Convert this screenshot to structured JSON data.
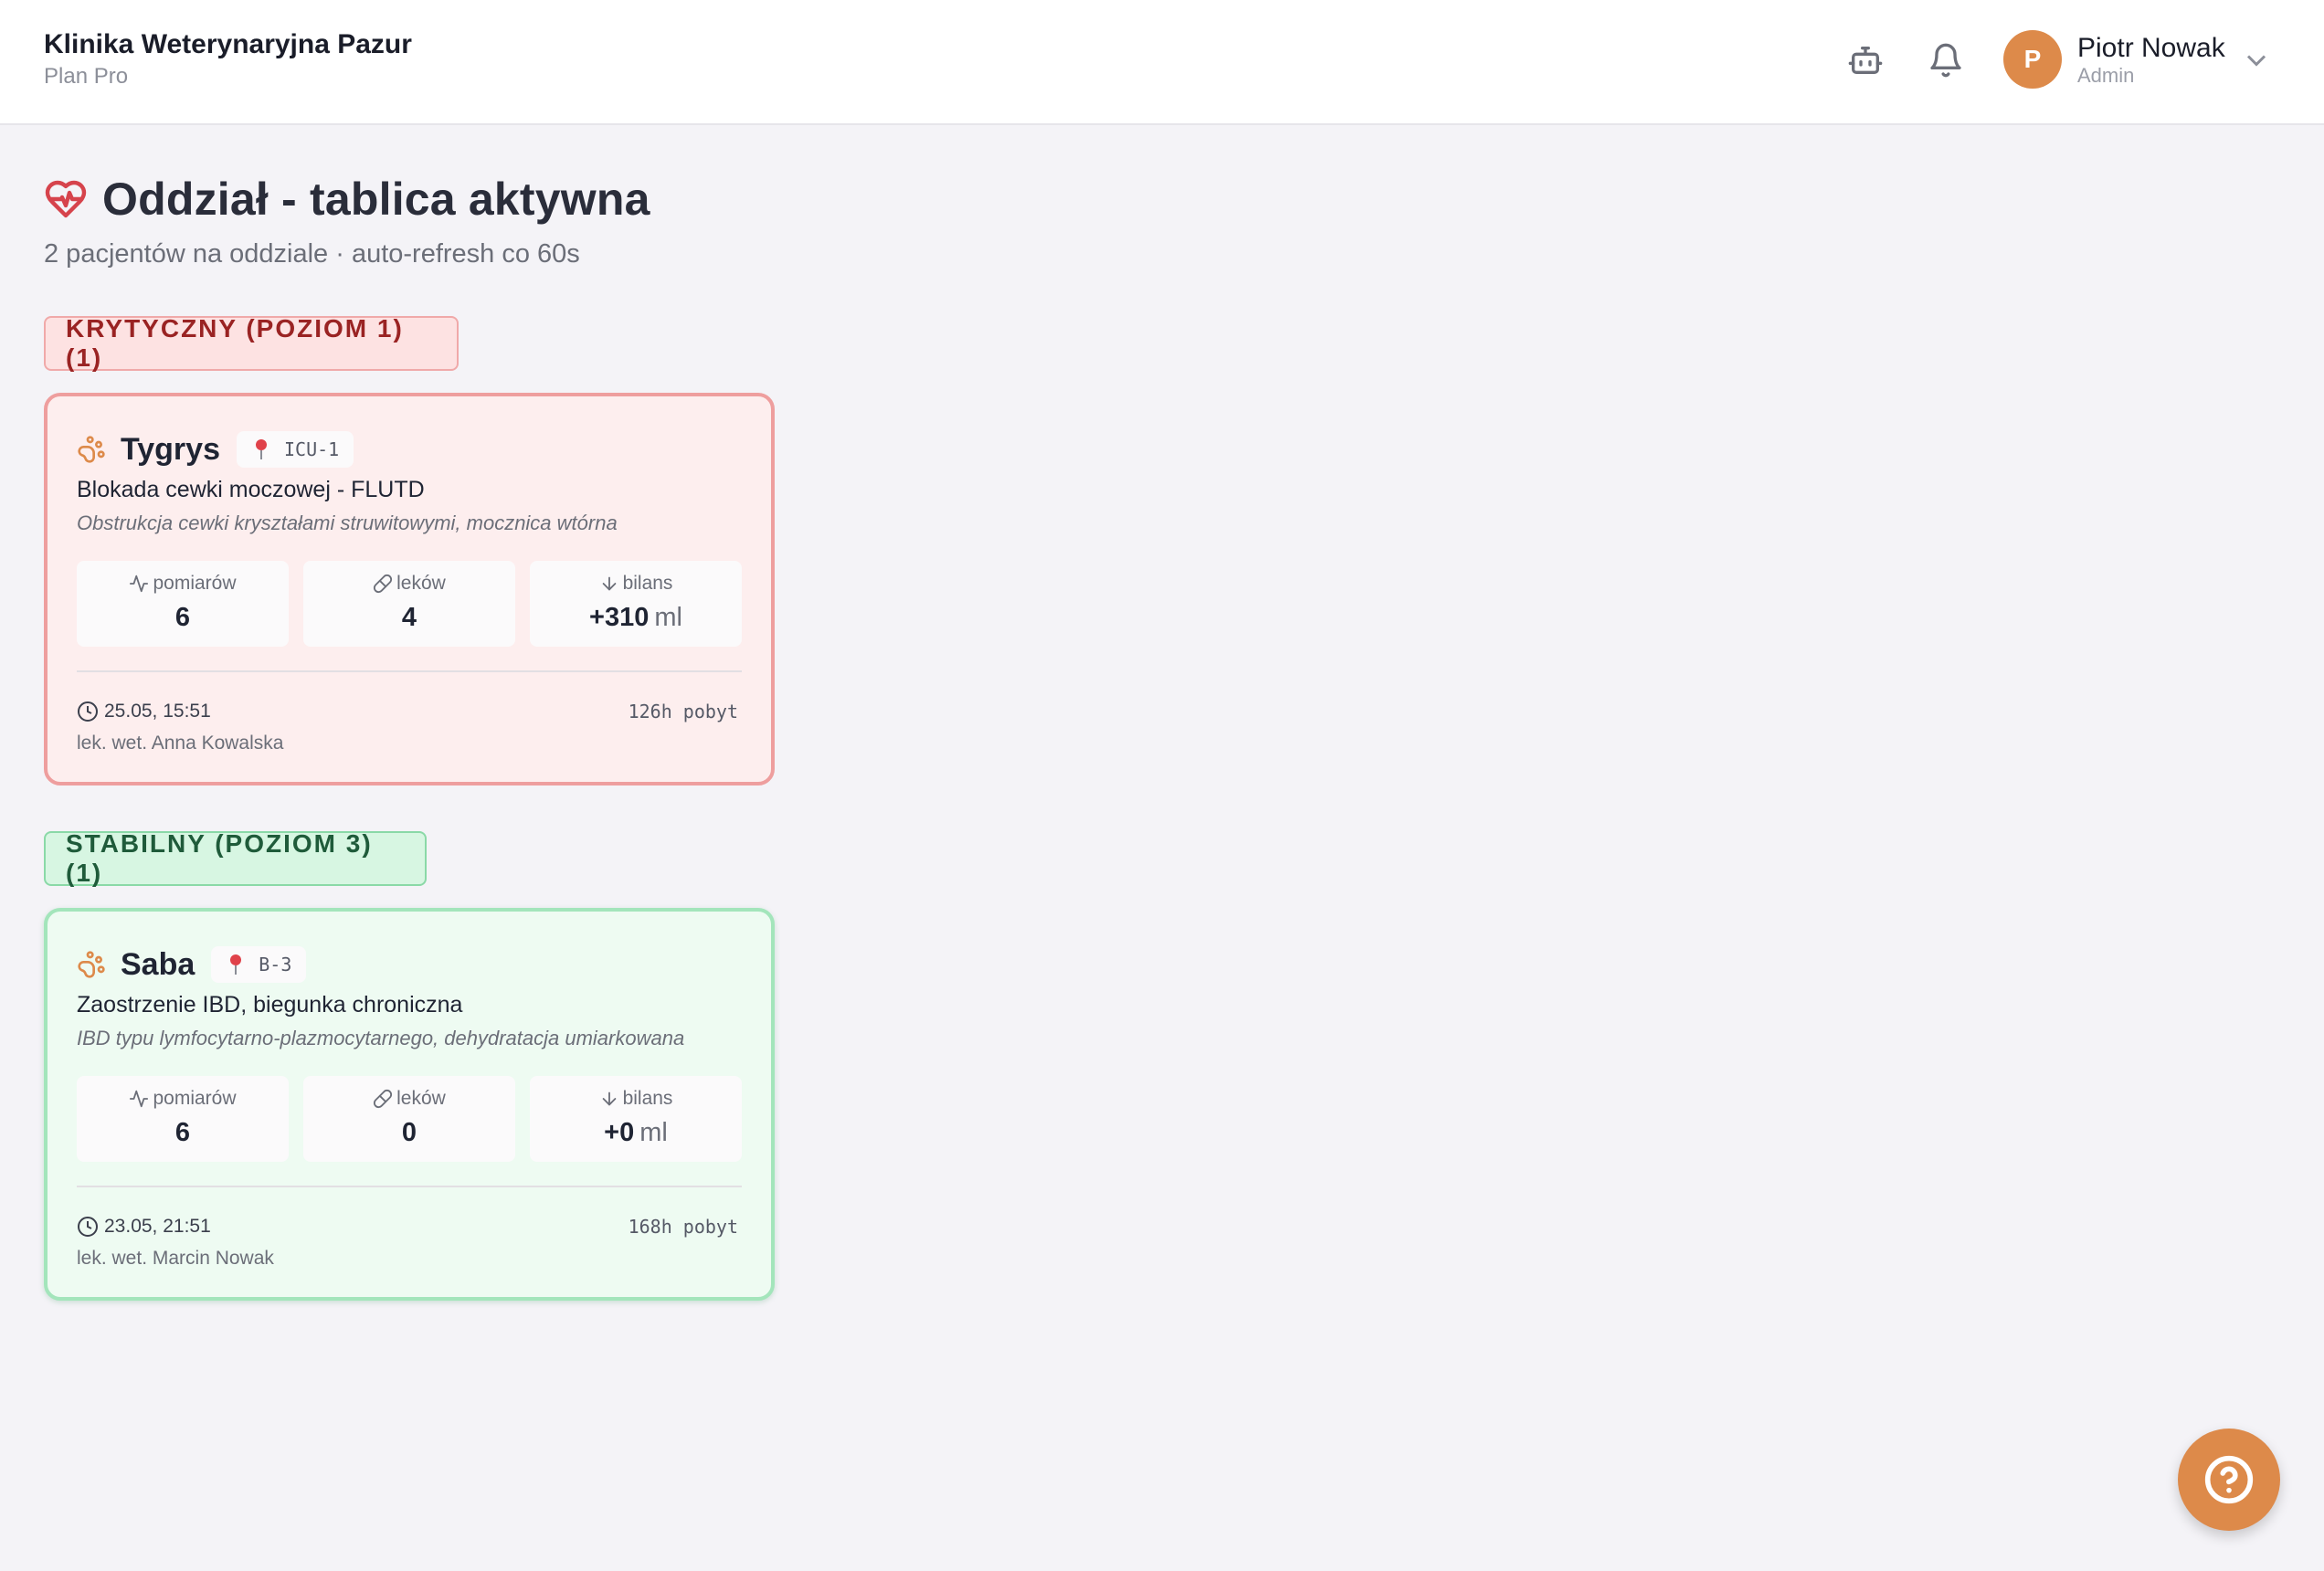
{
  "header": {
    "clinic_name": "Klinika Weterynaryjna Pazur",
    "plan": "Plan Pro",
    "icons": [
      "robot-icon",
      "bell-icon"
    ],
    "user": {
      "initial": "P",
      "name": "Piotr Nowak",
      "role": "Admin",
      "avatar_color": "#dd8a4a"
    }
  },
  "page": {
    "title": "Oddział - tablica aktywna",
    "subtitle": "2 pacjentów na oddziale · auto-refresh co 60s"
  },
  "groups": [
    {
      "label": "KRYTYCZNY (POZIOM 1) (1)",
      "color": "#9a2323",
      "patients": [
        {
          "name": "Tygrys",
          "location": "ICU-1",
          "diagnosis": "Blokada cewki moczowej - FLUTD",
          "detail": "Obstrukcja cewki kryształami struwitowymi, mocznica wtórna",
          "stats": {
            "measurements_label": "pomiarów",
            "measurements": "6",
            "meds_label": "leków",
            "meds": "4",
            "balance_label": "bilans",
            "balance": "+310",
            "balance_unit": "ml"
          },
          "admitted": "25.05, 15:51",
          "stay": "126h pobyt",
          "vet": "lek. wet. Anna Kowalska"
        }
      ]
    },
    {
      "label": "STABILNY (POZIOM 3) (1)",
      "color": "#1f5b3a",
      "patients": [
        {
          "name": "Saba",
          "location": "B-3",
          "diagnosis": "Zaostrzenie IBD, biegunka chroniczna",
          "detail": "IBD typu lymfocytarno-plazmocytarnego, dehydratacja umiarkowana",
          "stats": {
            "measurements_label": "pomiarów",
            "measurements": "6",
            "meds_label": "leków",
            "meds": "0",
            "balance_label": "bilans",
            "balance": "+0",
            "balance_unit": "ml"
          },
          "admitted": "23.05, 21:51",
          "stay": "168h pobyt",
          "vet": "lek. wet. Marcin Nowak"
        }
      ]
    }
  ],
  "accent_color": "#dd8a4a",
  "help_icon": "help-circle-icon"
}
